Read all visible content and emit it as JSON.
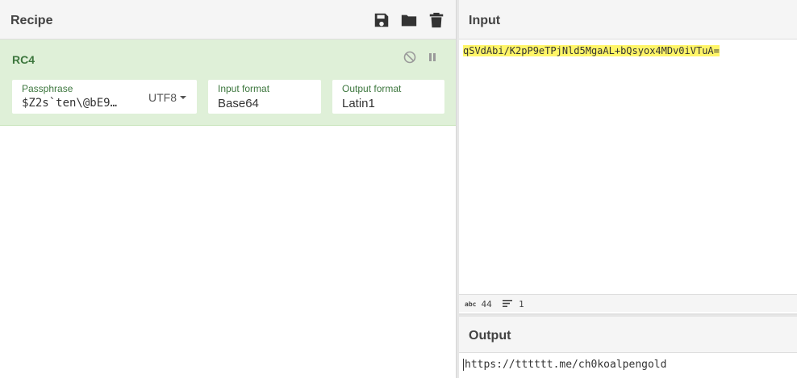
{
  "recipe": {
    "title": "Recipe",
    "icons": [
      "save-icon",
      "folder-icon",
      "trash-icon"
    ],
    "operation": {
      "name": "RC4",
      "controls": [
        "disable-icon",
        "pause-icon"
      ],
      "args": {
        "passphrase": {
          "label": "Passphrase",
          "value": "$Z2s`ten\\@bE9…",
          "encoding": "UTF8"
        },
        "input_format": {
          "label": "Input format",
          "value": "Base64"
        },
        "output_format": {
          "label": "Output format",
          "value": "Latin1"
        }
      }
    }
  },
  "input": {
    "title": "Input",
    "text": "qSVdAbi/K2pP9eTPjNld5MgaAL+bQsyox4MDv0iVTuA=",
    "status": {
      "length_icon": "abc",
      "length": "44",
      "lines": "1"
    }
  },
  "output": {
    "title": "Output",
    "text": "https://tttttt.me/ch0koalpengold"
  },
  "colors": {
    "operation_bg": "#dff0d8",
    "operation_text": "#3c763d",
    "highlight": "#fff568"
  }
}
